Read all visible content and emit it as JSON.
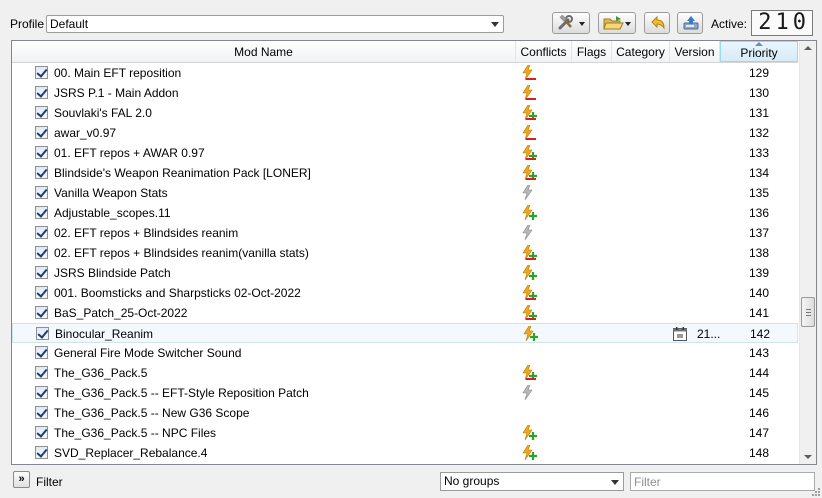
{
  "toolbar": {
    "profile_label": "Profile",
    "profile_value": "Default",
    "active_label": "Active:",
    "active_count": "210"
  },
  "columns": [
    "Mod Name",
    "Conflicts",
    "Flags",
    "Category",
    "Version",
    "Priority"
  ],
  "mods": [
    {
      "name": "00. Main EFT reposition",
      "conflict": "overwritten",
      "priority": "129"
    },
    {
      "name": "JSRS P.1 - Main Addon",
      "conflict": "overwritten",
      "priority": "130"
    },
    {
      "name": "Souvlaki's FAL 2.0",
      "conflict": "mixed",
      "priority": "131"
    },
    {
      "name": "awar_v0.97",
      "conflict": "overwritten",
      "priority": "132"
    },
    {
      "name": "01. EFT repos + AWAR 0.97",
      "conflict": "mixed",
      "priority": "133"
    },
    {
      "name": "Blindside's Weapon Reanimation Pack [LONER]",
      "conflict": "mixed",
      "priority": "134"
    },
    {
      "name": "Vanilla Weapon Stats",
      "conflict": "redundant",
      "priority": "135"
    },
    {
      "name": "Adjustable_scopes.11",
      "conflict": "overwrite",
      "priority": "136"
    },
    {
      "name": "02. EFT repos + Blindsides reanim",
      "conflict": "redundant",
      "priority": "137"
    },
    {
      "name": "02. EFT repos + Blindsides reanim(vanilla stats)",
      "conflict": "mixed",
      "priority": "138"
    },
    {
      "name": "JSRS Blindside Patch",
      "conflict": "overwrite",
      "priority": "139"
    },
    {
      "name": "001. Boomsticks and Sharpsticks 02-Oct-2022",
      "conflict": "mixed",
      "priority": "140"
    },
    {
      "name": "BaS_Patch_25-Oct-2022",
      "conflict": "mixed",
      "priority": "141"
    },
    {
      "name": "Binocular_Reanim",
      "conflict": "overwrite",
      "version": "21...",
      "priority": "142",
      "selected": true
    },
    {
      "name": "General Fire Mode Switcher Sound",
      "conflict": "",
      "priority": "143"
    },
    {
      "name": "The_G36_Pack.5",
      "conflict": "mixed",
      "priority": "144"
    },
    {
      "name": "The_G36_Pack.5 -- EFT-Style Reposition Patch",
      "conflict": "redundant",
      "priority": "145"
    },
    {
      "name": "The_G36_Pack.5 -- New G36 Scope",
      "conflict": "",
      "priority": "146"
    },
    {
      "name": "The_G36_Pack.5 -- NPC Files",
      "conflict": "overwrite",
      "priority": "147"
    },
    {
      "name": "SVD_Replacer_Rebalance.4",
      "conflict": "overwrite",
      "priority": "148"
    }
  ],
  "bottom": {
    "filter_label": "Filter",
    "groups_value": "No groups",
    "filter_placeholder": "Filter"
  },
  "icons": {
    "tools": "wrench-hammer-icon",
    "open_folder": "folder-open-icon",
    "restore": "undo-arrow-icon",
    "backup": "backup-disk-icon",
    "conflict_overwrite": "lightning-plus-icon",
    "conflict_overwritten": "lightning-minus-icon",
    "conflict_mixed": "lightning-plus-minus-icon",
    "conflict_redundant": "lightning-gray-icon",
    "version": "calendar-icon"
  },
  "colors": {
    "lightning": "#f0a81c",
    "plus": "#2fa12f",
    "minus": "#d42020",
    "selection_border": "#cfe3f3"
  }
}
